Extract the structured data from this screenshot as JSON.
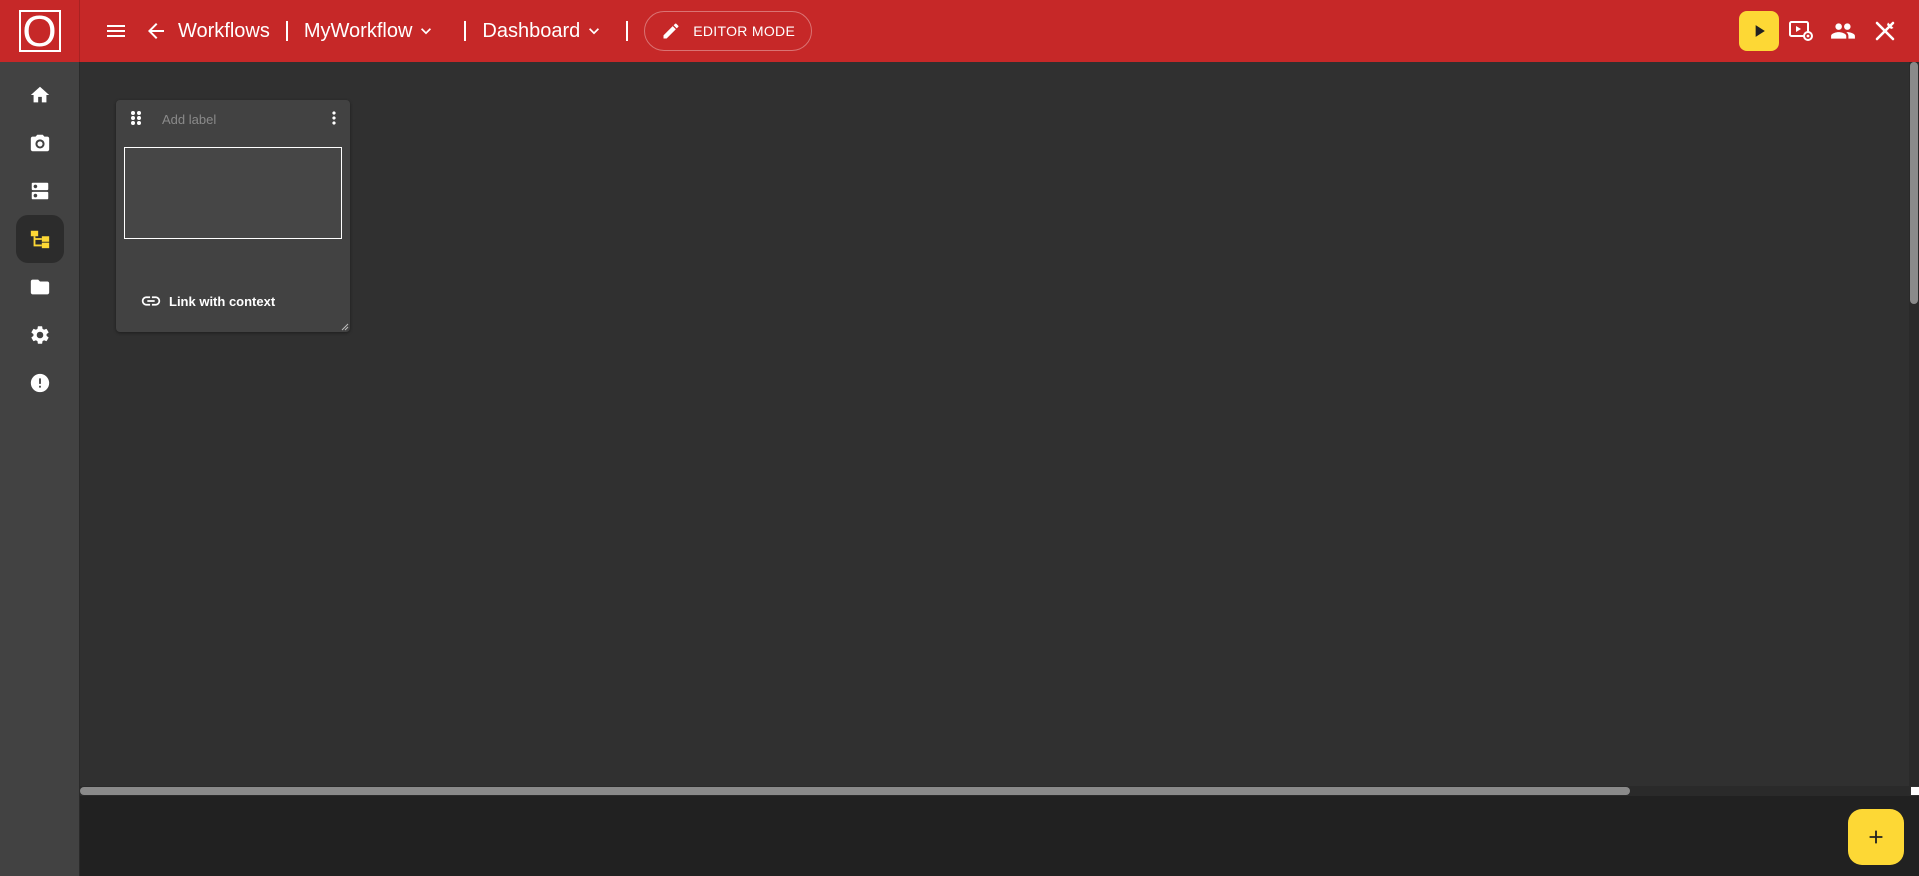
{
  "topbar": {
    "logo_letter": "O",
    "back_label": "Workflows",
    "workflow_name": "MyWorkflow",
    "view_name": "Dashboard",
    "editor_mode_label": "EDITOR MODE"
  },
  "sidebar": {
    "items": [
      {
        "name": "home",
        "icon": "home-icon",
        "active": false
      },
      {
        "name": "camera",
        "icon": "camera-icon",
        "active": false
      },
      {
        "name": "servers",
        "icon": "server-icon",
        "active": false
      },
      {
        "name": "workflows",
        "icon": "workflow-icon",
        "active": true
      },
      {
        "name": "files",
        "icon": "folder-icon",
        "active": false
      },
      {
        "name": "settings",
        "icon": "gear-icon",
        "active": false
      },
      {
        "name": "alerts",
        "icon": "alert-icon",
        "active": false
      }
    ]
  },
  "widget": {
    "label_placeholder": "Add label",
    "link_label": "Link with context"
  },
  "colors": {
    "topbar": "#c62828",
    "accent": "#fdd835",
    "canvas": "#303030",
    "sidebar": "#424242"
  }
}
